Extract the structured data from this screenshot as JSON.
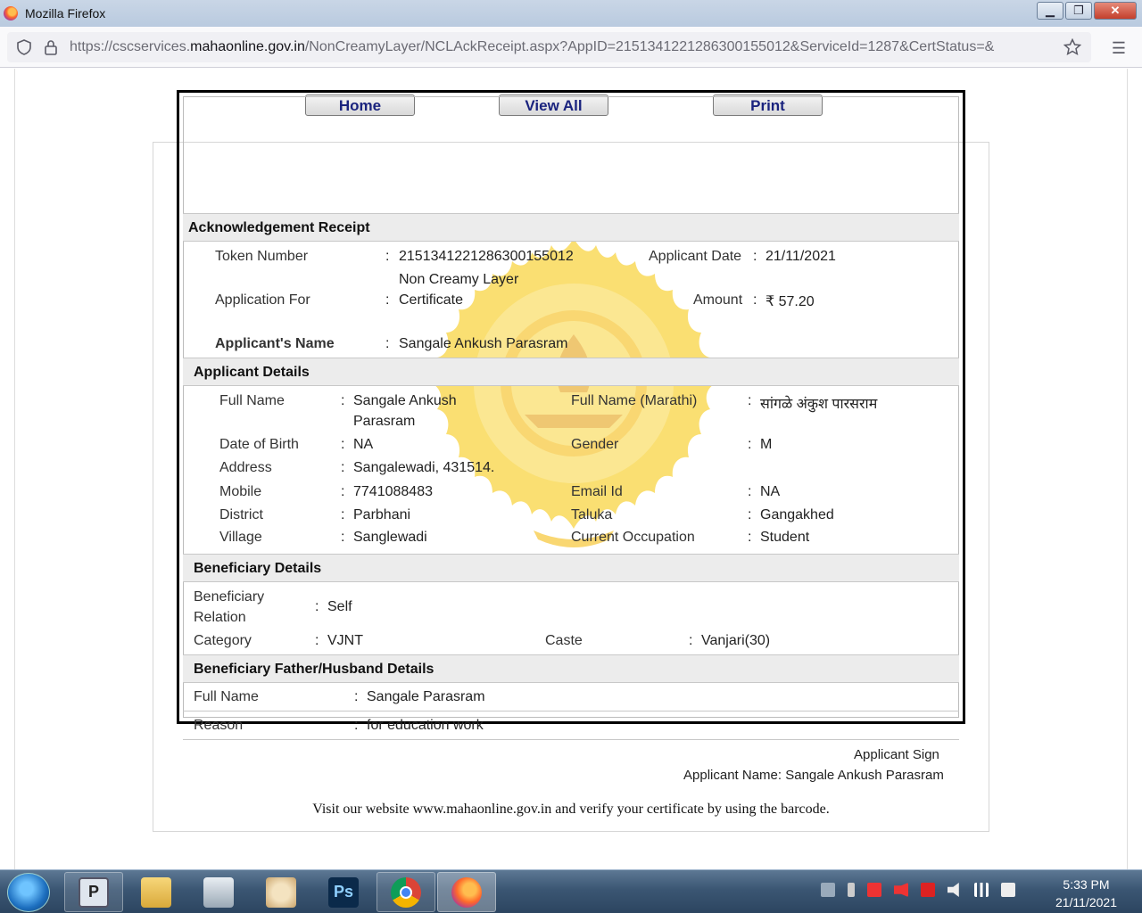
{
  "browser": {
    "window_title": "Mozilla Firefox",
    "url_prefix": "https://cscservices.",
    "url_domain": "mahaonline.gov.in",
    "url_path": "/NonCreamyLayer/NCLAckReceipt.aspx?AppID=2151341221286300155012&ServiceId=1287&CertStatus=&"
  },
  "buttons": {
    "home": "Home",
    "view_all": "View All",
    "print": "Print"
  },
  "receipt": {
    "title": "Acknowledgement Receipt",
    "token_label": "Token Number",
    "token_value": "2151341221286300155012",
    "appdate_label": "Applicant Date",
    "appdate_value": "21/11/2021",
    "appfor_label": "Application For",
    "appfor_value_line1": "Non Creamy Layer",
    "appfor_value_line2": "Certificate",
    "amount_label": "Amount",
    "amount_value": "₹ 57.20",
    "name_label": "Applicant's Name",
    "name_value": "Sangale Ankush Parasram",
    "sep": ":"
  },
  "applicant": {
    "title": "Applicant Details",
    "fullname_label": "Full Name",
    "fullname_line1": "Sangale Ankush",
    "fullname_line2": "Parasram",
    "fullname_mr_label": "Full Name (Marathi)",
    "fullname_mr_value": "सांगळे अंकुश पारसराम",
    "dob_label": "Date of Birth",
    "dob_value": "NA",
    "gender_label": "Gender",
    "gender_value": "M",
    "address_label": "Address",
    "address_value": "Sangalewadi, 431514.",
    "mobile_label": "Mobile",
    "mobile_value": "7741088483",
    "email_label": "Email Id",
    "email_value": "NA",
    "district_label": "District",
    "district_value": "Parbhani",
    "taluka_label": "Taluka",
    "taluka_value": "Gangakhed",
    "village_label": "Village",
    "village_value": "Sanglewadi",
    "occupation_label": "Current Occupation",
    "occupation_value": "Student"
  },
  "beneficiary": {
    "title": "Beneficiary Details",
    "relation_label_line1": "Beneficiary",
    "relation_label_line2": "Relation",
    "relation_value": "Self",
    "category_label": "Category",
    "category_value": "VJNT",
    "caste_label": "Caste",
    "caste_value": "Vanjari(30)"
  },
  "father": {
    "title": "Beneficiary Father/Husband Details",
    "fullname_label": "Full Name",
    "fullname_value": "Sangale Parasram",
    "reason_label": "Reason",
    "reason_value": "for education work"
  },
  "signature": {
    "sign_label": "Applicant Sign",
    "name_line": "Applicant Name: Sangale Ankush Parasram"
  },
  "footer_note": "Visit our website www.mahaonline.gov.in and verify your certificate by using the barcode.",
  "taskbar": {
    "items": [
      "photo-viewer",
      "file-explorer",
      "scanner",
      "paint",
      "photoshop",
      "chrome",
      "firefox"
    ],
    "photoshop_label": "Ps",
    "time": "5:33 PM",
    "date": "21/11/2021"
  },
  "colors": {
    "button_text": "#1a237e",
    "section_bg": "#ececec",
    "seal": "#f5b800"
  }
}
